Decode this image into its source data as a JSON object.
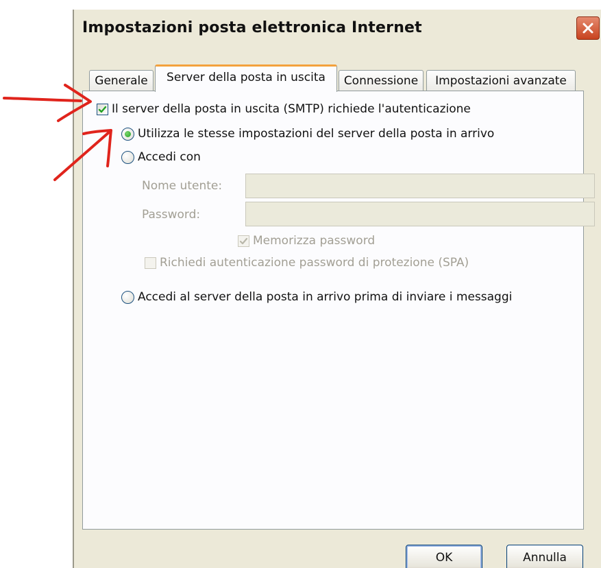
{
  "window": {
    "title": "Impostazioni posta elettronica Internet",
    "close_icon": "close-icon"
  },
  "tabs": [
    {
      "label": "Generale",
      "active": false
    },
    {
      "label": "Server della posta in uscita",
      "active": true
    },
    {
      "label": "Connessione",
      "active": false
    },
    {
      "label": "Impostazioni avanzate",
      "active": false
    }
  ],
  "outgoing": {
    "smtp_auth": {
      "label": "Il server della posta in uscita (SMTP) richiede l'autenticazione",
      "checked": true
    },
    "same_settings": {
      "label": "Utilizza le stesse impostazioni del server della posta in arrivo",
      "selected": true
    },
    "login_with": {
      "label": "Accedi con",
      "selected": false
    },
    "username": {
      "label": "Nome utente:",
      "value": ""
    },
    "password": {
      "label": "Password:",
      "value": ""
    },
    "remember_password": {
      "label": "Memorizza password",
      "checked": true,
      "disabled": true
    },
    "spa": {
      "label": "Richiedi autenticazione password di protezione (SPA)",
      "checked": false,
      "disabled": true
    },
    "login_before": {
      "label": "Accedi al server della posta in arrivo prima di inviare i messaggi",
      "selected": false
    }
  },
  "buttons": {
    "ok": "OK",
    "cancel": "Annulla"
  },
  "colors": {
    "window_bg": "#ece9d8",
    "panel_bg": "#fcfcfe",
    "tab_accent": "#f3a13c",
    "check_green": "#21a121",
    "annotation_red": "#e0241c",
    "close_red": "#c8431f"
  }
}
